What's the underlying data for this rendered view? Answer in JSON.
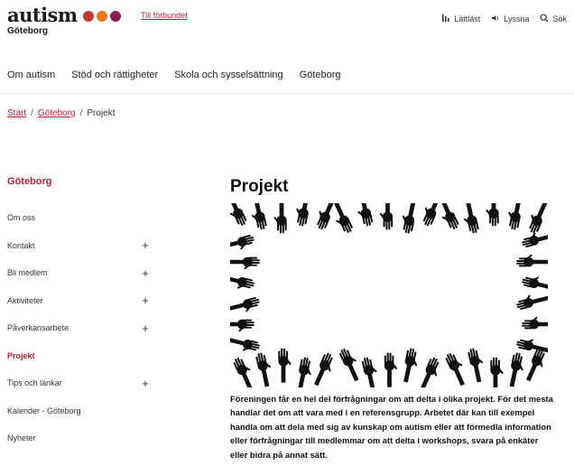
{
  "header": {
    "logo_word": "autism",
    "logo_sub": "Göteborg",
    "dot_colors": [
      "#c0392b",
      "#e87722",
      "#8e1d54"
    ],
    "federation_link": "Till förbundet",
    "tools": [
      {
        "icon": "reading-icon",
        "label": "Lättläst"
      },
      {
        "icon": "speaker-icon",
        "label": "Lyssna"
      },
      {
        "icon": "search-icon",
        "label": "Sök"
      }
    ]
  },
  "nav": {
    "items": [
      "Om autism",
      "Stöd och rättigheter",
      "Skola och sysselsättning",
      "Göteborg"
    ]
  },
  "breadcrumb": {
    "items": [
      {
        "label": "Start",
        "link": true
      },
      {
        "label": "Göteborg",
        "link": true
      },
      {
        "label": "Projekt",
        "link": false
      }
    ]
  },
  "sidebar": {
    "title": "Göteborg",
    "items": [
      {
        "label": "Om oss",
        "expandable": false,
        "active": false
      },
      {
        "label": "Kontakt",
        "expandable": true,
        "active": false
      },
      {
        "label": "Bli medlem",
        "expandable": true,
        "active": false
      },
      {
        "label": "Aktiviteter",
        "expandable": true,
        "active": false
      },
      {
        "label": "Påverkansarbete",
        "expandable": true,
        "active": false
      },
      {
        "label": "Projekt",
        "expandable": false,
        "active": true
      },
      {
        "label": "Tips och länkar",
        "expandable": true,
        "active": false
      },
      {
        "label": "Kalender - Göteborg",
        "expandable": false,
        "active": false
      },
      {
        "label": "Nyheter",
        "expandable": false,
        "active": false
      }
    ],
    "expand_symbol": "+"
  },
  "content": {
    "title": "Projekt",
    "intro": "Föreningen får en hel del förfrågningar om att delta i olika projekt. För det mesta handlar det om att vara med i en referensgrupp. Arbetet där kan till exempel handla om att dela med sig av kunskap om autism eller att förmedla information eller förfrågningar till medlemmar om att delta i workshops, svara på enkäter eller bidra på annat sätt."
  },
  "colors": {
    "accent": "#b8243a",
    "text": "#1a1a1a"
  }
}
